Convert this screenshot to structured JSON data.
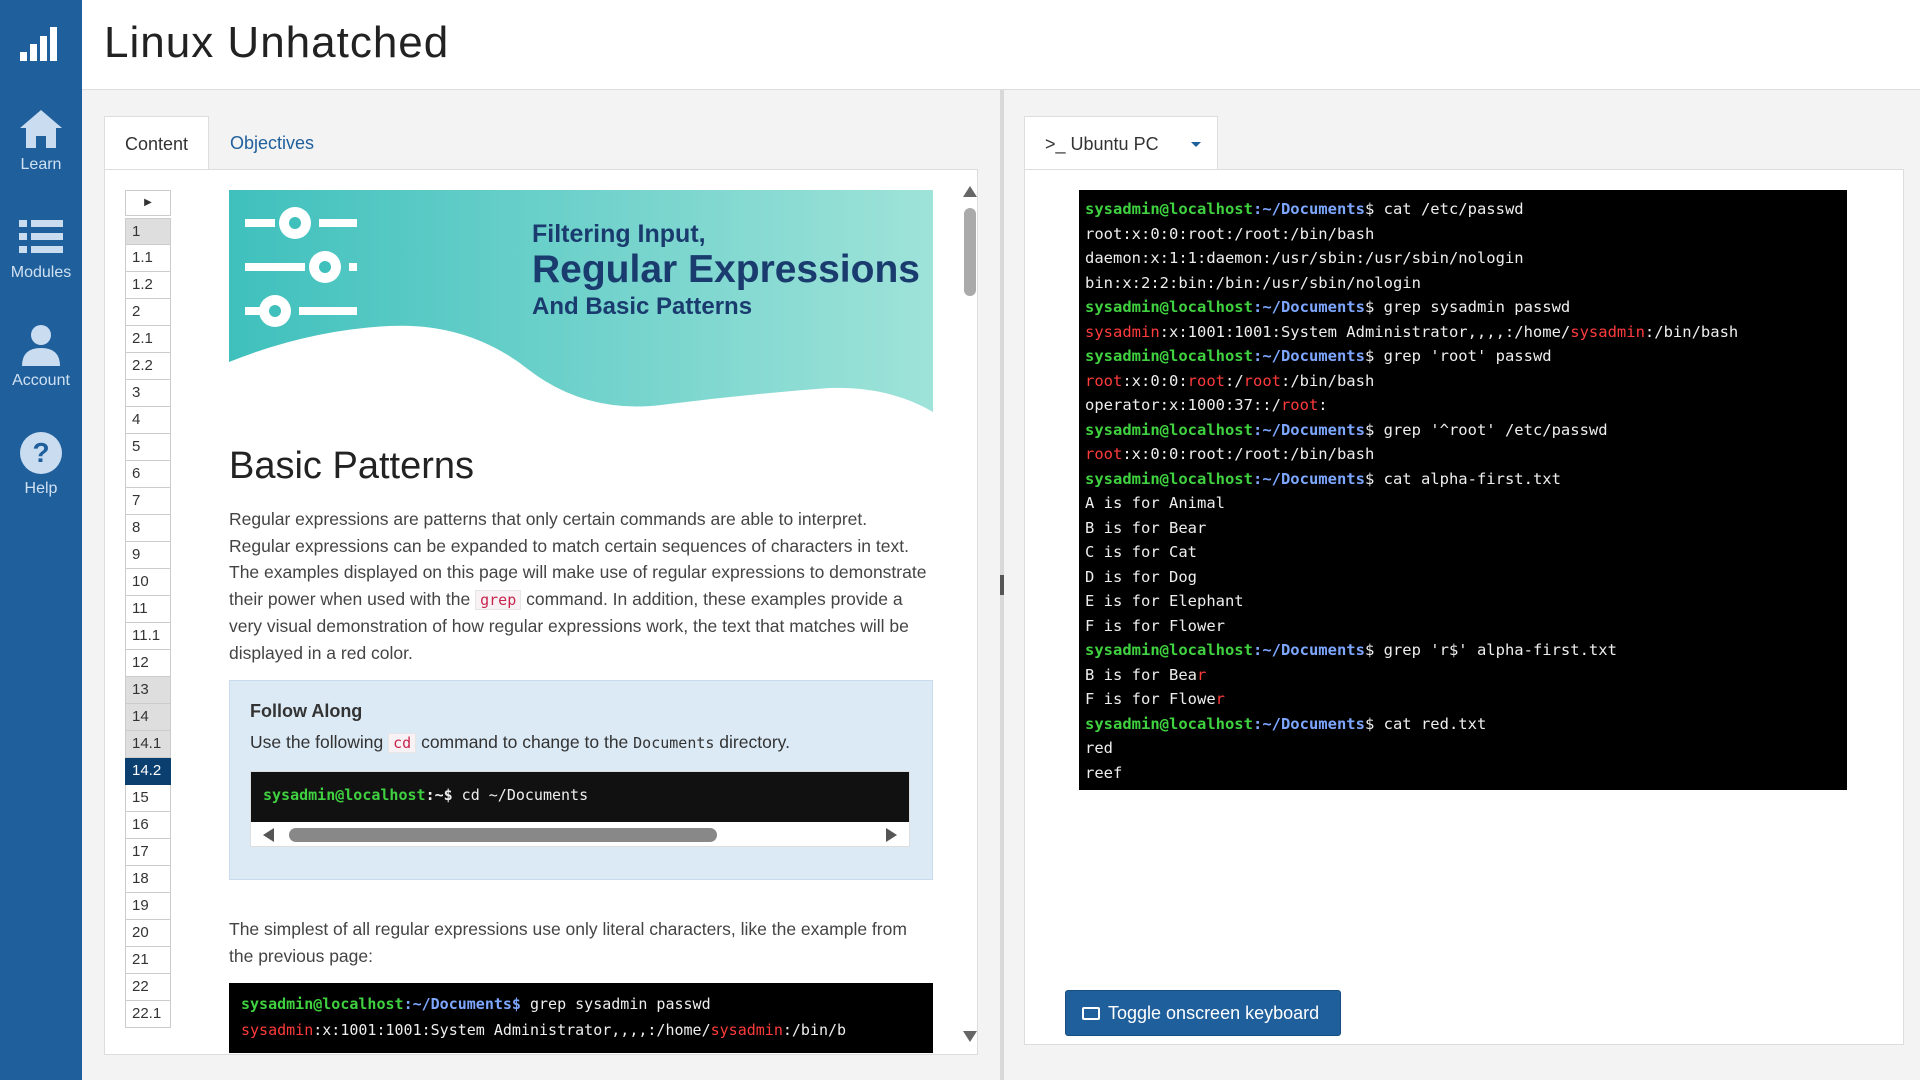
{
  "header": {
    "title": "Linux Unhatched"
  },
  "sidebar": {
    "items": [
      {
        "label": "Learn",
        "icon": "home-icon"
      },
      {
        "label": "Modules",
        "icon": "list-icon"
      },
      {
        "label": "Account",
        "icon": "user-icon"
      },
      {
        "label": "Help",
        "icon": "help-icon"
      }
    ]
  },
  "tabs": {
    "content": "Content",
    "objectives": "Objectives"
  },
  "toc": {
    "items": [
      "1",
      "1.1",
      "1.2",
      "2",
      "2.1",
      "2.2",
      "3",
      "4",
      "5",
      "6",
      "7",
      "8",
      "9",
      "10",
      "11",
      "11.1",
      "12",
      "13",
      "14",
      "14.1",
      "14.2",
      "15",
      "16",
      "17",
      "18",
      "19",
      "20",
      "21",
      "22",
      "22.1"
    ],
    "visited": [
      "1",
      "13",
      "14",
      "14.1"
    ],
    "current": "14.2"
  },
  "banner": {
    "line1": "Filtering Input,",
    "line2": "Regular Expressions",
    "line3": "And Basic Patterns"
  },
  "lesson": {
    "heading": "Basic Patterns",
    "para1_a": "Regular expressions are patterns that only certain commands are able to interpret. Regular expressions can be expanded to match certain sequences of characters in text. The examples displayed on this page will make use of regular expressions to demonstrate their power when used with the ",
    "para1_code": "grep",
    "para1_b": " command. In addition, these examples provide a very visual demonstration of how regular expressions work, the text that matches will be displayed in a red color.",
    "follow_title": "Follow Along",
    "follow_a": "Use the following ",
    "follow_code1": "cd",
    "follow_b": " command to change to the ",
    "follow_code2": "Documents",
    "follow_c": " directory.",
    "follow_prompt_user": "sysadmin@localhost",
    "follow_prompt_path": ":~$",
    "follow_cmd": " cd ~/Documents",
    "para2": "The simplest of all regular expressions use only literal characters, like the example from the previous page:",
    "term_prompt_user": "sysadmin@localhost",
    "term_prompt_path": ":~/Documents$",
    "term_cmd": " grep sysadmin passwd",
    "term_out_user1": "sysadmin",
    "term_out_mid": ":x:1001:1001:System Administrator,,,,:/home/",
    "term_out_user2": "sysadmin",
    "term_out_tail": ":/bin/b"
  },
  "right": {
    "tab_label": ">_ Ubuntu PC",
    "keyboard_button": "Toggle onscreen keyboard",
    "prompt_user": "sysadmin@localhost",
    "prompt_path": ":~/Documents",
    "terminal_lines": [
      [
        {
          "t": "p"
        },
        {
          "t": "txt",
          "v": "$ cat /etc/passwd"
        }
      ],
      [
        {
          "t": "txt",
          "v": "root:x:0:0:root:/root:/bin/bash"
        }
      ],
      [
        {
          "t": "txt",
          "v": "daemon:x:1:1:daemon:/usr/sbin:/usr/sbin/nologin"
        }
      ],
      [
        {
          "t": "txt",
          "v": "bin:x:2:2:bin:/bin:/usr/sbin/nologin"
        }
      ],
      [
        {
          "t": "p"
        },
        {
          "t": "txt",
          "v": "$ grep sysadmin passwd"
        }
      ],
      [
        {
          "t": "m",
          "v": "sysadmin"
        },
        {
          "t": "txt",
          "v": ":x:1001:1001:System Administrator,,,,:/home/"
        },
        {
          "t": "m",
          "v": "sysadmin"
        },
        {
          "t": "txt",
          "v": ":/bin/bash"
        }
      ],
      [
        {
          "t": "p"
        },
        {
          "t": "txt",
          "v": "$ grep 'root' passwd"
        }
      ],
      [
        {
          "t": "m",
          "v": "root"
        },
        {
          "t": "txt",
          "v": ":x:0:0:"
        },
        {
          "t": "m",
          "v": "root"
        },
        {
          "t": "txt",
          "v": ":/"
        },
        {
          "t": "m",
          "v": "root"
        },
        {
          "t": "txt",
          "v": ":/bin/bash"
        }
      ],
      [
        {
          "t": "txt",
          "v": "operator:x:1000:37::/"
        },
        {
          "t": "m",
          "v": "root"
        },
        {
          "t": "txt",
          "v": ":"
        }
      ],
      [
        {
          "t": "p"
        },
        {
          "t": "txt",
          "v": "$ grep '^root' /etc/passwd"
        }
      ],
      [
        {
          "t": "m",
          "v": "root"
        },
        {
          "t": "txt",
          "v": ":x:0:0:root:/root:/bin/bash"
        }
      ],
      [
        {
          "t": "p"
        },
        {
          "t": "txt",
          "v": "$ cat alpha-first.txt"
        }
      ],
      [
        {
          "t": "txt",
          "v": "A is for Animal"
        }
      ],
      [
        {
          "t": "txt",
          "v": "B is for Bear"
        }
      ],
      [
        {
          "t": "txt",
          "v": "C is for Cat"
        }
      ],
      [
        {
          "t": "txt",
          "v": "D is for Dog"
        }
      ],
      [
        {
          "t": "txt",
          "v": "E is for Elephant"
        }
      ],
      [
        {
          "t": "txt",
          "v": "F is for Flower"
        }
      ],
      [
        {
          "t": "p"
        },
        {
          "t": "txt",
          "v": "$ grep 'r$' alpha-first.txt"
        }
      ],
      [
        {
          "t": "txt",
          "v": "B is for Bea"
        },
        {
          "t": "m",
          "v": "r"
        }
      ],
      [
        {
          "t": "txt",
          "v": "F is for Flowe"
        },
        {
          "t": "m",
          "v": "r"
        }
      ],
      [
        {
          "t": "p"
        },
        {
          "t": "txt",
          "v": "$ cat red.txt"
        }
      ],
      [
        {
          "t": "txt",
          "v": "red"
        }
      ],
      [
        {
          "t": "txt",
          "v": "reef"
        }
      ]
    ]
  },
  "colors": {
    "sidebar": "#1f5f9c",
    "prompt_user": "#3fd13f",
    "prompt_path": "#7da7ff",
    "match": "#ff3b3b",
    "current_toc": "#0b3f6f"
  }
}
